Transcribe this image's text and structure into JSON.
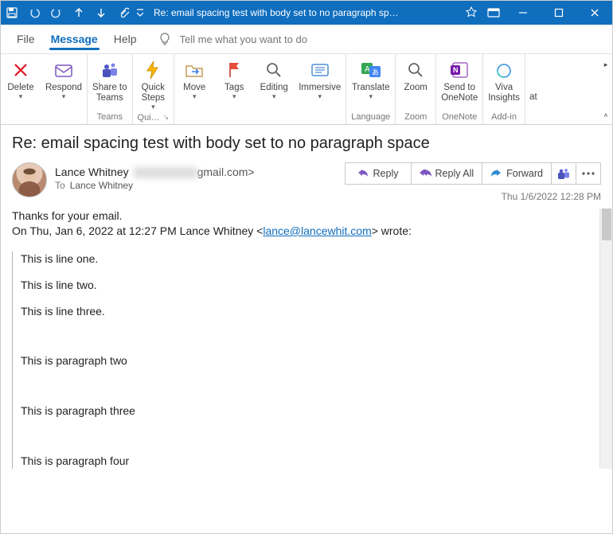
{
  "titlebar": {
    "title": "Re: email spacing test with body set to no paragraph sp…"
  },
  "menu": {
    "file": "File",
    "message": "Message",
    "help": "Help",
    "tellme": "Tell me what you want to do"
  },
  "ribbon": {
    "delete": "Delete",
    "respond": "Respond",
    "share_teams": "Share to\nTeams",
    "teams_group": "Teams",
    "quick_steps": "Quick\nSteps",
    "quick_group": "Qui…",
    "move": "Move",
    "tags": "Tags",
    "editing": "Editing",
    "immersive": "Immersive",
    "translate": "Translate",
    "language_group": "Language",
    "zoom": "Zoom",
    "zoom_group": "Zoom",
    "onenote": "Send to\nOneNote",
    "onenote_group": "OneNote",
    "viva": "Viva\nInsights",
    "addin_group": "Add-in",
    "overflow": "at"
  },
  "email": {
    "subject": "Re: email spacing test with body set to no paragraph space",
    "from_name": "Lance Whitney",
    "from_email_visible": "gmail.com>",
    "to_label": "To",
    "to_recipient": "Lance Whitney",
    "reply": "Reply",
    "reply_all": "Reply All",
    "forward": "Forward",
    "datetime": "Thu 1/6/2022 12:28 PM"
  },
  "body": {
    "thanks": "Thanks for your email.",
    "quote_intro_pre": "On Thu, Jan 6, 2022 at 12:27 PM Lance Whitney <",
    "quote_intro_link": "lance@lancewhit.com",
    "quote_intro_post": "> wrote:",
    "l1": "This is line one.",
    "l2": "This is line two.",
    "l3": "This is line three.",
    "p2": "This is paragraph two",
    "p3": "This is paragraph three",
    "p4": "This is paragraph four"
  }
}
